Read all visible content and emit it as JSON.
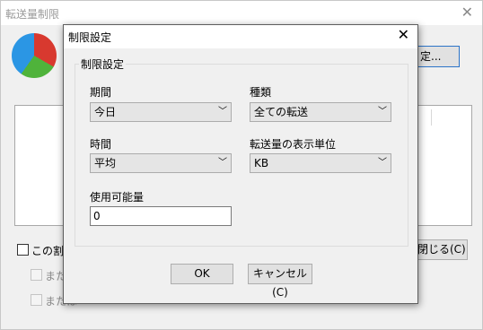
{
  "background_window": {
    "title": "転送量制限",
    "top_button_label": "定...",
    "checkbox_label": "この割合",
    "sub_option_1_label": "または",
    "sub_option_2_label": "または",
    "close_button_label": "閉じる(C)"
  },
  "dialog": {
    "title": "制限設定",
    "group_title": "制限設定",
    "period": {
      "label": "期間",
      "value": "今日"
    },
    "type": {
      "label": "種類",
      "value": "全ての転送"
    },
    "time": {
      "label": "時間",
      "value": "平均"
    },
    "unit": {
      "label": "転送量の表示単位",
      "value": "KB"
    },
    "available": {
      "label": "使用可能量",
      "value": "0"
    },
    "ok_label": "OK",
    "cancel_label": "キャンセル(C)"
  }
}
